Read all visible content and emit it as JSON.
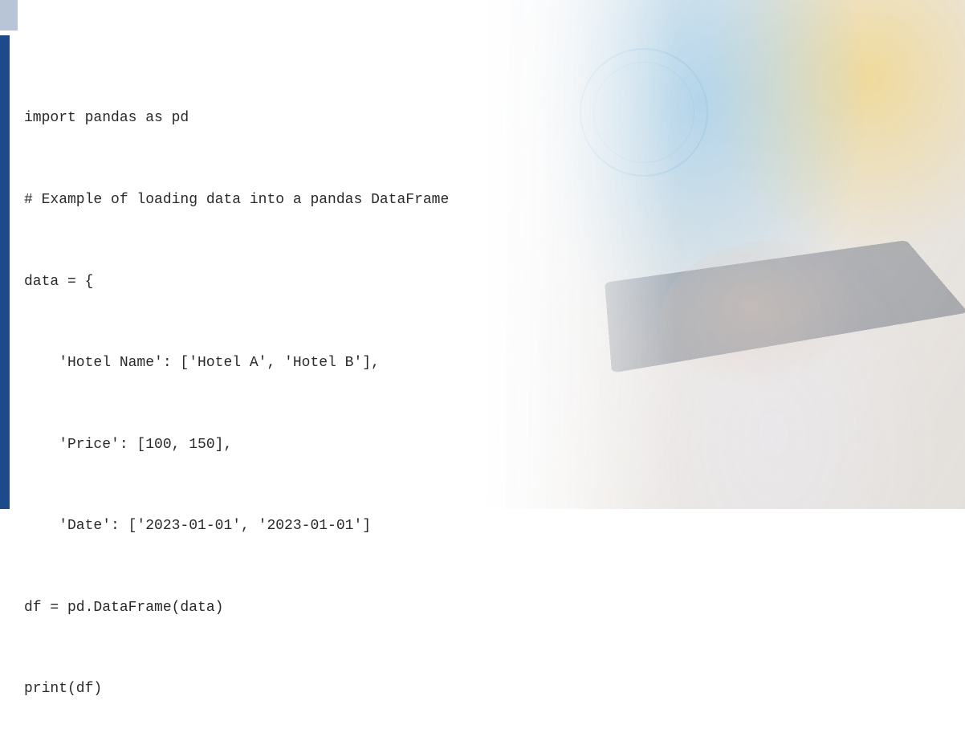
{
  "code": {
    "lines": [
      "import pandas as pd",
      "# Example of loading data into a pandas DataFrame",
      "data = {",
      "    'Hotel Name': ['Hotel A', 'Hotel B'],",
      "    'Price': [100, 150],",
      "    'Date': ['2023-01-01', '2023-01-01']",
      "df = pd.DataFrame(data)",
      "print(df)"
    ]
  }
}
